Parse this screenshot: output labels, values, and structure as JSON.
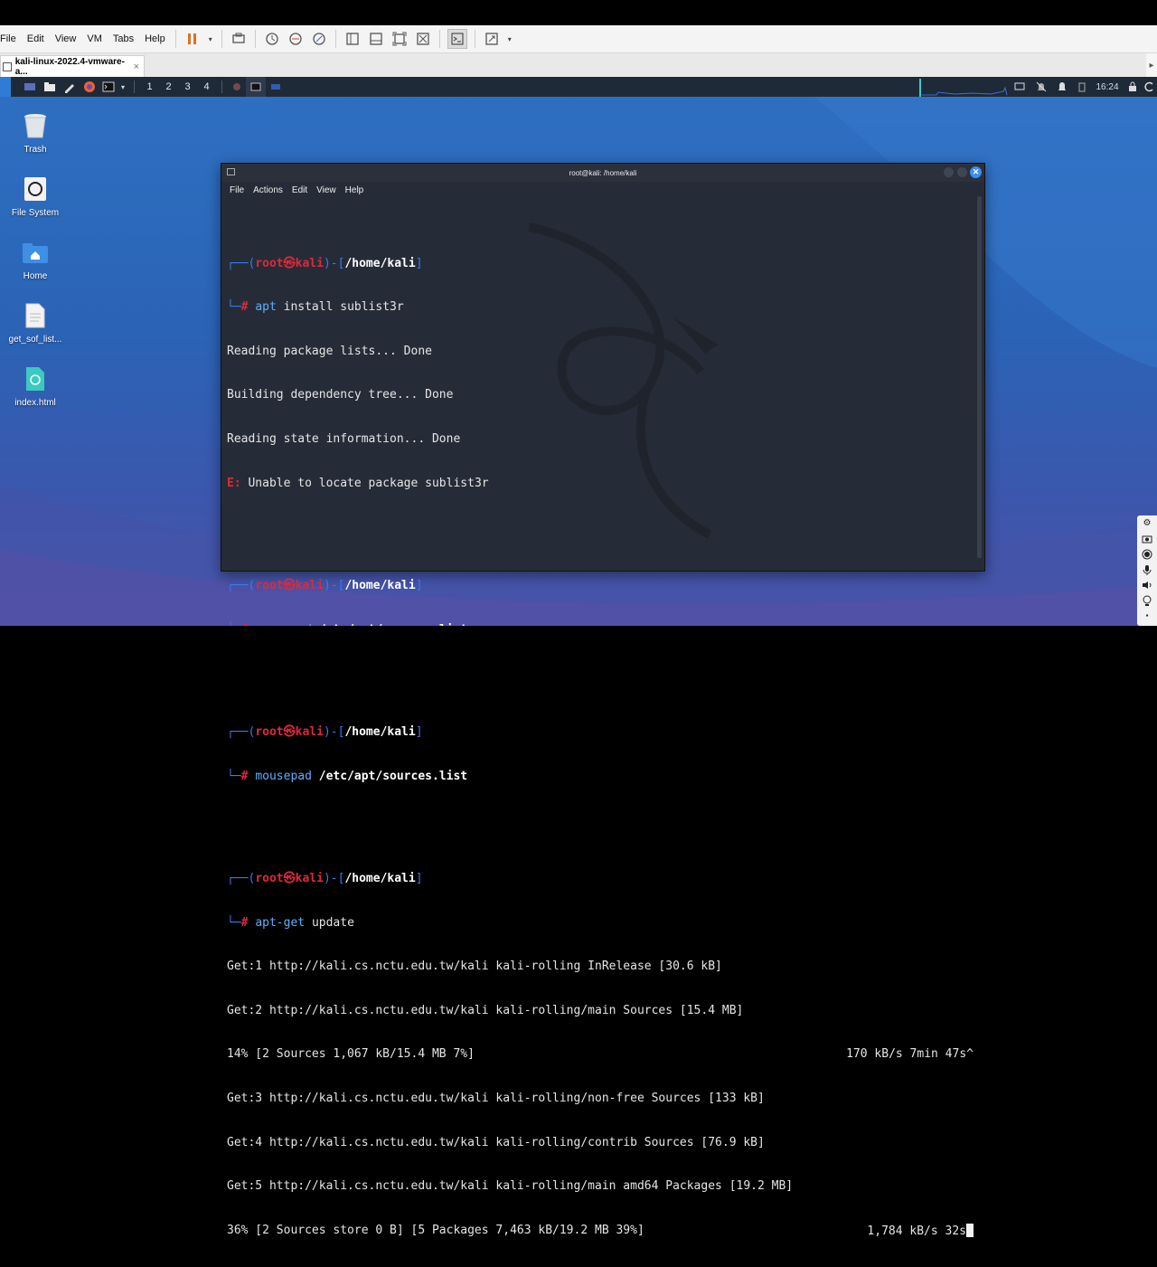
{
  "vmware": {
    "menu": [
      "File",
      "Edit",
      "View",
      "VM",
      "Tabs",
      "Help"
    ],
    "tab_title": "kali-linux-2022.4-vmware-a...",
    "tab_close": "×"
  },
  "panel": {
    "workspaces": [
      "1",
      "2",
      "3",
      "4"
    ],
    "clock": "16:24"
  },
  "desktop_icons": [
    {
      "label": "Trash",
      "icon": "trash-icon"
    },
    {
      "label": "File System",
      "icon": "drive-icon"
    },
    {
      "label": "Home",
      "icon": "home-folder-icon"
    },
    {
      "label": "get_sof_list...",
      "icon": "text-file-icon"
    },
    {
      "label": "index.html",
      "icon": "html-file-icon"
    }
  ],
  "terminal": {
    "title": "root@kali: /home/kali",
    "menu": [
      "File",
      "Actions",
      "Edit",
      "View",
      "Help"
    ],
    "prompt": {
      "user": "root",
      "host": "kali",
      "dir": "/home/kali",
      "skull": "㉿"
    },
    "block1": {
      "cmd": "apt",
      "args": "install sublist3r",
      "output": [
        "Reading package lists... Done",
        "Building dependency tree... Done",
        "Reading state information... Done"
      ],
      "error_prefix": "E:",
      "error": "Unable to locate package sublist3r"
    },
    "block2": {
      "cmd": "mousepad",
      "args": "/etc/apt/sources.list"
    },
    "block3": {
      "cmd": "mousepad",
      "args": "/etc/apt/sources.list"
    },
    "block4": {
      "cmd": "apt-get",
      "args": "update",
      "lines": [
        {
          "left": "Get:1 http://kali.cs.nctu.edu.tw/kali kali-rolling InRelease [30.6 kB]",
          "right": ""
        },
        {
          "left": "Get:2 http://kali.cs.nctu.edu.tw/kali kali-rolling/main Sources [15.4 MB]",
          "right": ""
        },
        {
          "left": "14% [2 Sources 1,067 kB/15.4 MB 7%]",
          "right": "170 kB/s 7min 47s^"
        },
        {
          "left": "Get:3 http://kali.cs.nctu.edu.tw/kali kali-rolling/non-free Sources [133 kB]",
          "right": ""
        },
        {
          "left": "Get:4 http://kali.cs.nctu.edu.tw/kali kali-rolling/contrib Sources [76.9 kB]",
          "right": ""
        },
        {
          "left": "Get:5 http://kali.cs.nctu.edu.tw/kali kali-rolling/main amd64 Packages [19.2 MB]",
          "right": ""
        },
        {
          "left": "36% [2 Sources store 0 B] [5 Packages 7,463 kB/19.2 MB 39%]",
          "right": "1,784 kB/s 32s"
        }
      ]
    }
  },
  "colors": {
    "desktop": "#2e6fc1",
    "terminal_bg": "#262c37",
    "prompt_blue": "#367bf0",
    "prompt_red": "#e0283b",
    "panel": "#1f2a38"
  }
}
